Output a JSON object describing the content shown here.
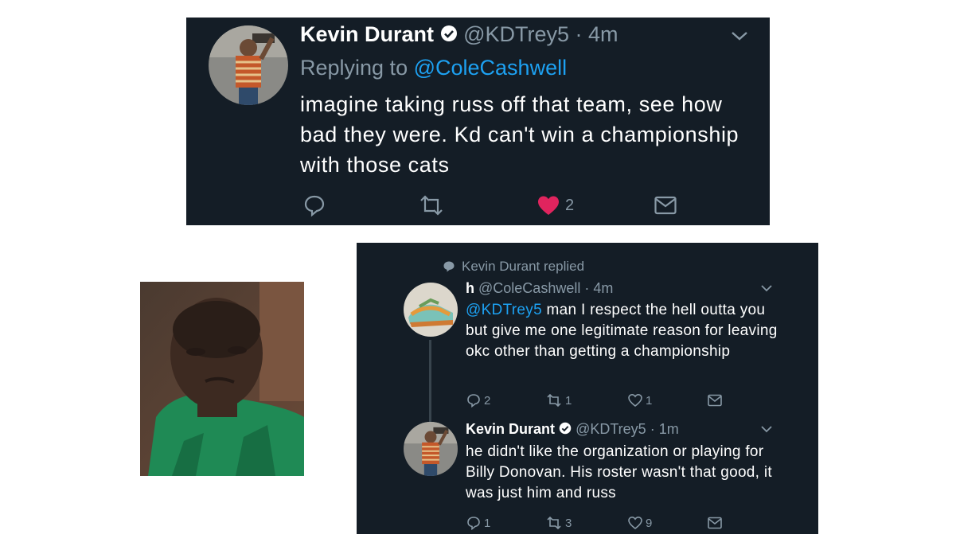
{
  "top_tweet": {
    "name": "Kevin Durant",
    "handle": "@KDTrey5",
    "time": "· 4m",
    "replying_prefix": "Replying to",
    "replying_to": "@ColeCashwell",
    "text": "imagine taking russ off that team, see how bad they were. Kd can't win a championship with those cats",
    "likes": "2",
    "like_color": "#e0245e"
  },
  "thread": {
    "replied_label": "Kevin Durant replied",
    "original": {
      "name": "h",
      "handle": "@ColeCashwell",
      "time": "· 4m",
      "mention": "@KDTrey5",
      "text": " man I respect the hell outta you but give me one legitimate reason for leaving okc other than getting a championship",
      "replies": "2",
      "retweets": "1",
      "likes": "1"
    },
    "reply": {
      "name": "Kevin Durant",
      "handle": "@KDTrey5",
      "time": "· 1m",
      "text": "he didn't like the organization or playing for Billy Donovan. His roster wasn't that good, it was just him and russ",
      "replies": "1",
      "retweets": "3",
      "likes": "9"
    }
  },
  "colors": {
    "panel_bg": "#141d26",
    "link": "#1da1f2",
    "muted": "#8899a6",
    "like": "#e0245e"
  }
}
